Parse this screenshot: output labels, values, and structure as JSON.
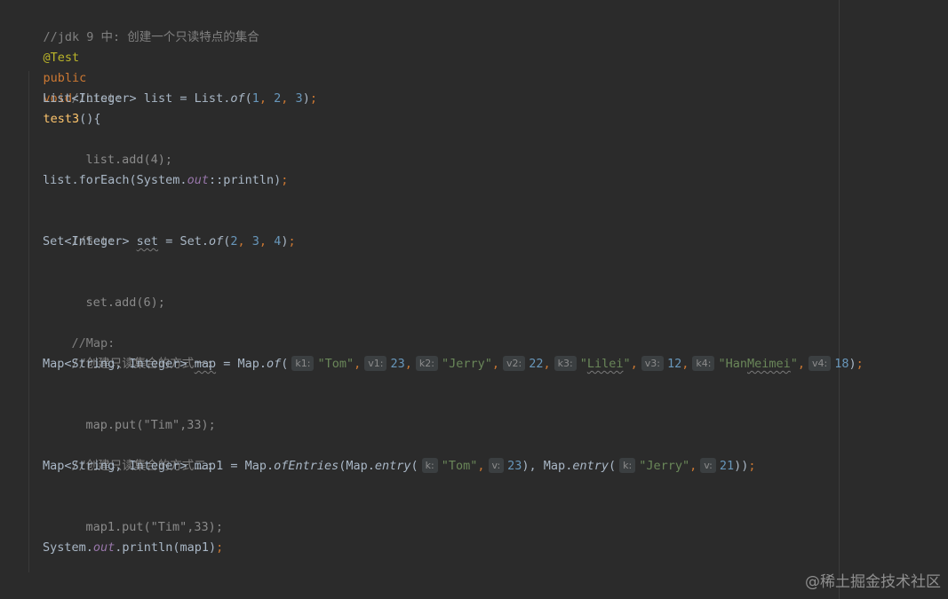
{
  "code": {
    "l1_comment": "//jdk 9 中: 创建一个只读特点的集合",
    "l2_annotation": "@Test",
    "l3_public": "public",
    "l3_void": "void",
    "l3_method": "test3",
    "l3_rest": "(){",
    "l4_comment": "//List:",
    "l5_a": "List<Integer> list = List.",
    "l5_of": "of",
    "l5_open": "(",
    "l5_n1": "1",
    "l5_c1": ", ",
    "l5_n2": "2",
    "l5_c2": ", ",
    "l5_n3": "3",
    "l5_close": ")",
    "l5_semi": ";",
    "l6": "list.add(4);",
    "l7_a": "list.forEach(System.",
    "l7_out": "out",
    "l7_b": "::println)",
    "l7_semi": ";",
    "l8_comment": "//Set:",
    "l9_a": "Set<Integer> ",
    "l9_set": "set",
    "l9_b": " = Set.",
    "l9_of": "of",
    "l9_open": "(",
    "l9_n1": "2",
    "l9_c1": ", ",
    "l9_n2": "3",
    "l9_c2": ", ",
    "l9_n3": "4",
    "l9_close": ")",
    "l9_semi": ";",
    "l10": "set.add(6);",
    "l11_comment": "//Map:",
    "l12_comment": "//创建只读集合的方式一:",
    "l13_a": "Map<String, Integer> ",
    "l13_map": "map",
    "l13_b": " = Map.",
    "l13_of": "of",
    "l13_open": "(",
    "l13_h1": "k1:",
    "l13_s1": "\"Tom\"",
    "l13_c1": ",",
    "l13_h2": "v1:",
    "l13_n1": "23",
    "l13_c2": ",",
    "l13_h3": "k2:",
    "l13_s2": "\"Jerry\"",
    "l13_c3": ",",
    "l13_h4": "v2:",
    "l13_n2": "22",
    "l13_c4": ",",
    "l13_h5": "k3:",
    "l13_s3_q1": "\"",
    "l13_s3_w": "Lilei",
    "l13_s3_q2": "\"",
    "l13_c5": ",",
    "l13_h6": "v3:",
    "l13_n3": "12",
    "l13_c6": ",",
    "l13_h7": "k4:",
    "l13_s4_a": "\"Han",
    "l13_s4_w": "Meimei",
    "l13_s4_b": "\"",
    "l13_c7": ",",
    "l13_h8": "v4:",
    "l13_n4": "18",
    "l13_close": ")",
    "l13_semi": ";",
    "l14": "map.put(\"Tim\",33);",
    "l15_comment": "//创建只读集合的方式二:",
    "l16_a": "Map<String, Integer> map1 = Map.",
    "l16_ofEntries": "ofEntries",
    "l16_b": "(Map.",
    "l16_entry1": "entry",
    "l16_open1": "(",
    "l16_h1": "k:",
    "l16_s1": "\"Tom\"",
    "l16_c1": ",",
    "l16_h2": "v:",
    "l16_n1": "23",
    "l16_c2": "), Map.",
    "l16_entry2": "entry",
    "l16_open2": "(",
    "l16_h3": "k:",
    "l16_s2": "\"Jerry\"",
    "l16_c3": ",",
    "l16_h4": "v:",
    "l16_n2": "21",
    "l16_close": "))",
    "l16_semi": ";",
    "l17": "map1.put(\"Tim\",33);",
    "l18_a": "System.",
    "l18_out": "out",
    "l18_b": ".println(map1)",
    "l18_semi": ";",
    "l19_brace": "}"
  },
  "watermark": "@稀土掘金技术社区",
  "colors": {
    "background": "#2b2b2b",
    "default_text": "#a9b7c6",
    "comment": "#808080",
    "annotation": "#bbb529",
    "keyword": "#cc7832",
    "method_declaration": "#ffc66d",
    "number": "#6897bb",
    "string": "#6a8759",
    "static_field": "#9876aa",
    "inlay_hint_background": "#3b3f41"
  }
}
